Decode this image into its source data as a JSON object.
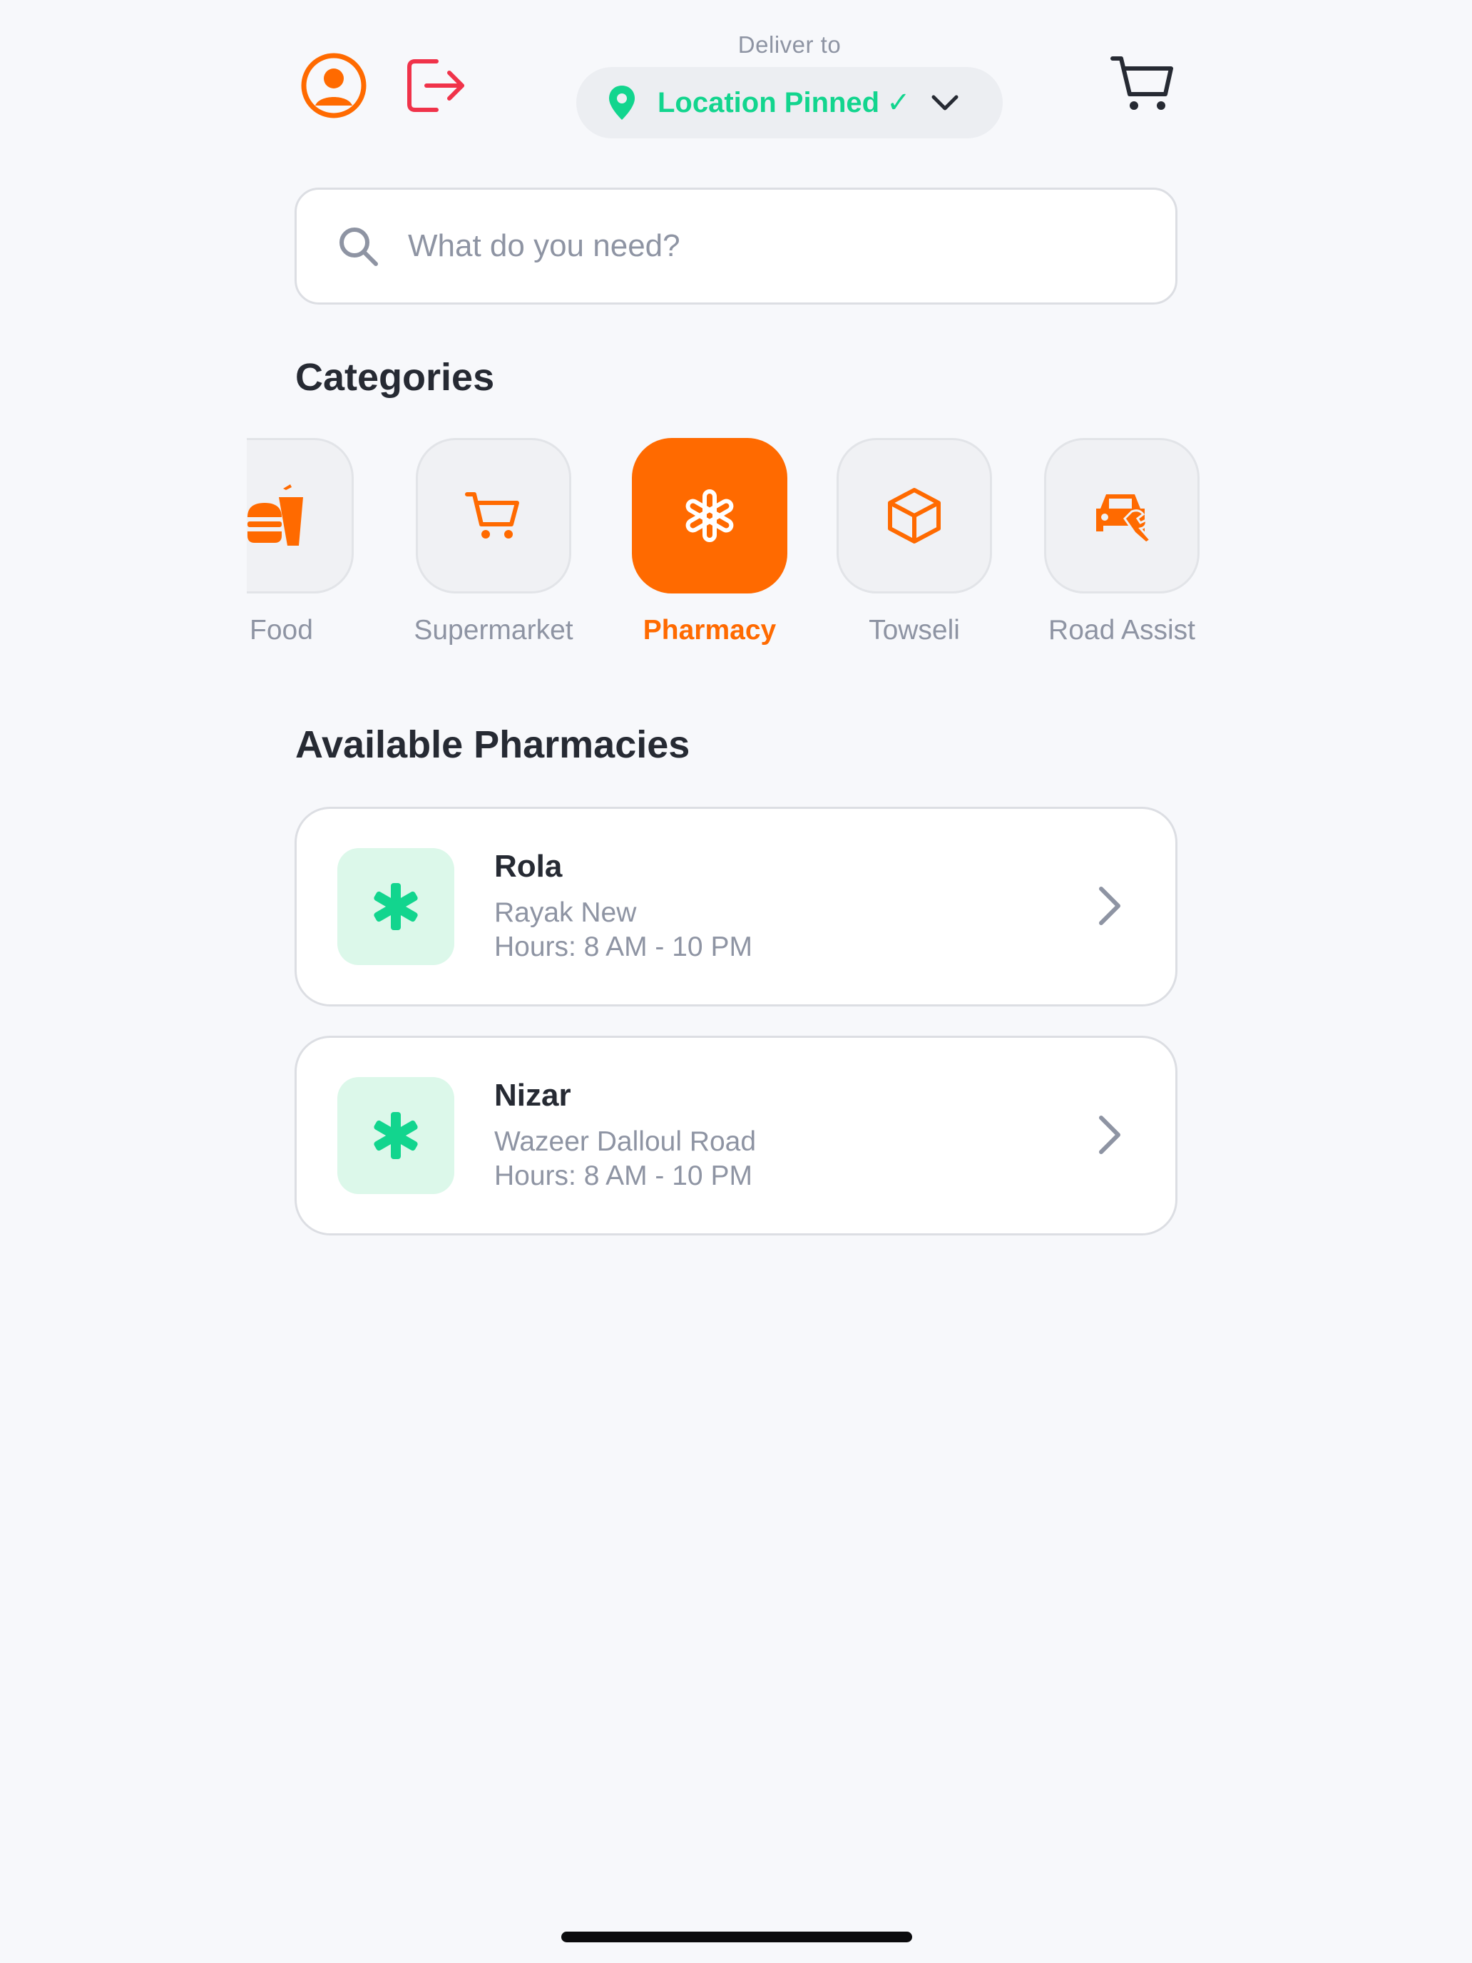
{
  "header": {
    "deliver_to_label": "Deliver to",
    "location_text": "Location Pinned",
    "location_check": "✓"
  },
  "search": {
    "placeholder": "What do you need?",
    "value": ""
  },
  "categories_title": "Categories",
  "categories": [
    {
      "label": "Food",
      "icon": "burger-drink-icon",
      "active": false
    },
    {
      "label": "Supermarket",
      "icon": "shopping-cart-icon",
      "active": false
    },
    {
      "label": "Pharmacy",
      "icon": "asterisk-icon",
      "active": true
    },
    {
      "label": "Towseli",
      "icon": "package-box-icon",
      "active": false
    },
    {
      "label": "Road Assist",
      "icon": "car-wrench-icon",
      "active": false
    }
  ],
  "pharmacies_title": "Available Pharmacies",
  "pharmacies": [
    {
      "name": "Rola",
      "address": "Rayak New",
      "hours": "Hours: 8 AM - 10 PM"
    },
    {
      "name": "Nizar",
      "address": "Wazeer Dalloul Road",
      "hours": "Hours: 8 AM - 10 PM"
    }
  ],
  "colors": {
    "accent": "#ff6a00",
    "success": "#12d58e",
    "logout": "#f0334a",
    "background": "#f7f8fb"
  }
}
